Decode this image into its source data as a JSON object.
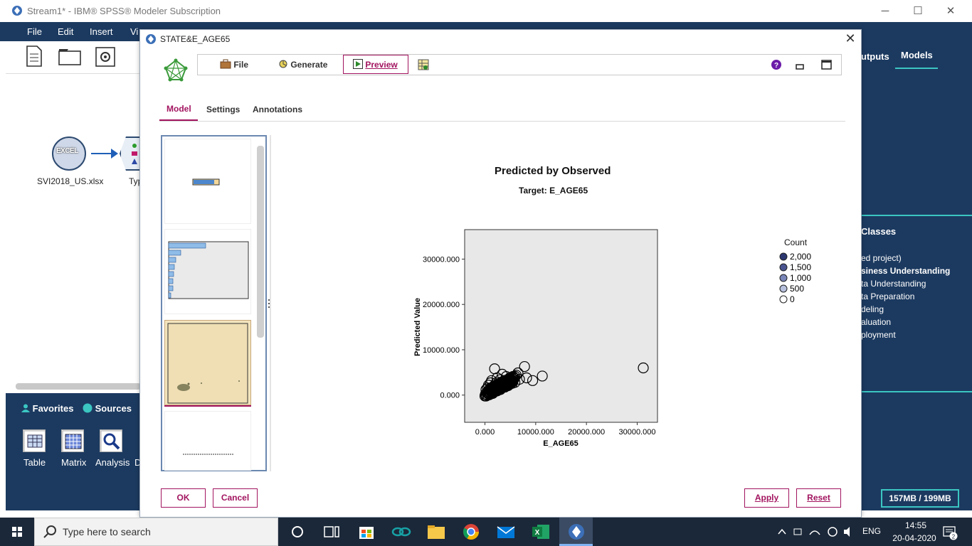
{
  "app": {
    "title": "Stream1* - IBM® SPSS® Modeler Subscription",
    "menu": [
      "File",
      "Edit",
      "Insert",
      "Vi"
    ],
    "window_controls": [
      "minimize",
      "maximize",
      "close"
    ]
  },
  "canvas": {
    "source_node_label": "SVI2018_US.xlsx",
    "source_node_badge": "EXCEL",
    "type_node_label": "Typ"
  },
  "palette": {
    "tabs": [
      "Favorites",
      "Sources"
    ],
    "items": [
      "Table",
      "Matrix",
      "Analysis",
      "D"
    ]
  },
  "right_panel": {
    "tabs": [
      "utputs",
      "Models"
    ],
    "section_title": "Classes",
    "items": [
      "ed project)",
      "siness Understanding",
      "ta Understanding",
      "ta Preparation",
      "deling",
      "aluation",
      "ployment"
    ],
    "memory": "157MB / 199MB"
  },
  "dialog": {
    "title": "STATE&E_AGE65",
    "toolbar": {
      "file": "File",
      "generate": "Generate",
      "preview": "Preview"
    },
    "tabs": [
      "Model",
      "Settings",
      "Annotations"
    ],
    "buttons": {
      "ok": "OK",
      "cancel": "Cancel",
      "apply": "Apply",
      "reset": "Reset"
    }
  },
  "chart_data": {
    "type": "scatter",
    "title": "Predicted by Observed",
    "subtitle": "Target: E_AGE65",
    "xlabel": "E_AGE65",
    "ylabel": "Predicted Value",
    "x_ticks": [
      "0.000",
      "10000.000",
      "20000.000",
      "30000.000"
    ],
    "y_ticks": [
      "0.000",
      "10000.000",
      "20000.000",
      "30000.000"
    ],
    "xlim": [
      -4000,
      34000
    ],
    "ylim": [
      -6000,
      36500
    ],
    "legend_title": "Count",
    "legend": [
      "2,000",
      "1,500",
      "1,000",
      "500",
      "0"
    ],
    "legend_colors": [
      "#2c3770",
      "#4a5590",
      "#7a86b8",
      "#b7c0dc",
      "#ffffff"
    ],
    "points": [
      {
        "x": 31200,
        "y": 6000
      },
      {
        "x": 11300,
        "y": 4200
      },
      {
        "x": 9400,
        "y": 3200
      },
      {
        "x": 7800,
        "y": 6300
      },
      {
        "x": 1900,
        "y": 5800
      },
      {
        "x": 6500,
        "y": 4900
      },
      {
        "x": 8200,
        "y": 3800
      },
      {
        "x": 5400,
        "y": 2600
      },
      {
        "x": 3000,
        "y": 3400
      },
      {
        "x": 4200,
        "y": 4100
      },
      {
        "x": 2200,
        "y": 2700
      },
      {
        "x": 1000,
        "y": 1500
      },
      {
        "x": 600,
        "y": 900
      },
      {
        "x": 300,
        "y": 500
      },
      {
        "x": 100,
        "y": 200
      },
      {
        "x": 2600,
        "y": 2200
      },
      {
        "x": 3800,
        "y": 3000
      },
      {
        "x": 4800,
        "y": 3600
      },
      {
        "x": 1600,
        "y": 1800
      },
      {
        "x": 2900,
        "y": 1600
      },
      {
        "x": 5900,
        "y": 2800
      },
      {
        "x": 700,
        "y": 2200
      },
      {
        "x": 1300,
        "y": 3200
      },
      {
        "x": 3400,
        "y": 4600
      },
      {
        "x": 200,
        "y": 1200
      },
      {
        "x": 800,
        "y": 400
      },
      {
        "x": 2000,
        "y": 1000
      },
      {
        "x": 3600,
        "y": 1900
      },
      {
        "x": 4500,
        "y": 2400
      },
      {
        "x": 6800,
        "y": 3500
      },
      {
        "x": 1100,
        "y": 2700
      },
      {
        "x": 2400,
        "y": 3800
      },
      {
        "x": 500,
        "y": 1600
      }
    ]
  },
  "taskbar": {
    "search_placeholder": "Type here to search",
    "lang": "ENG",
    "time": "14:55",
    "date": "20-04-2020",
    "notification_count": "2"
  }
}
